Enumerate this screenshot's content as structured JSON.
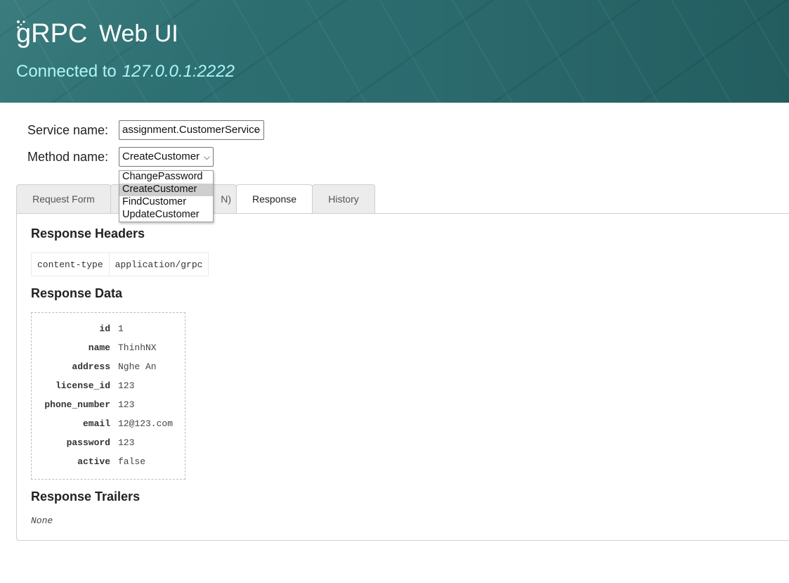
{
  "header": {
    "logo_text": "gRPC",
    "title": "Web UI",
    "connected_label": "Connected to",
    "connected_address": "127.0.0.1:2222"
  },
  "form": {
    "service_label": "Service name:",
    "service_value": "assignment.CustomerService",
    "method_label": "Method name:",
    "method_value": "CreateCustomer"
  },
  "method_dropdown": {
    "options": [
      "ChangePassword",
      "CreateCustomer",
      "FindCustomer",
      "UpdateCustomer"
    ],
    "selected": "CreateCustomer"
  },
  "tabs": [
    {
      "label": "Request Form",
      "active": false
    },
    {
      "label": "N)",
      "active": false
    },
    {
      "label": "Response",
      "active": true
    },
    {
      "label": "History",
      "active": false
    }
  ],
  "response": {
    "headers_title": "Response Headers",
    "headers": [
      {
        "name": "content-type",
        "value": "application/grpc"
      }
    ],
    "data_title": "Response Data",
    "data": [
      {
        "key": "id",
        "value": "1"
      },
      {
        "key": "name",
        "value": "ThinhNX"
      },
      {
        "key": "address",
        "value": "Nghe An"
      },
      {
        "key": "license_id",
        "value": "123"
      },
      {
        "key": "phone_number",
        "value": "123"
      },
      {
        "key": "email",
        "value": "12@123.com"
      },
      {
        "key": "password",
        "value": "123"
      },
      {
        "key": "active",
        "value": "false"
      }
    ],
    "trailers_title": "Response Trailers",
    "trailers_value": "None"
  },
  "colors": {
    "header_bg": "#2b6d70",
    "connected_text": "#aef5f7",
    "dropdown_selected": "#cecece"
  }
}
